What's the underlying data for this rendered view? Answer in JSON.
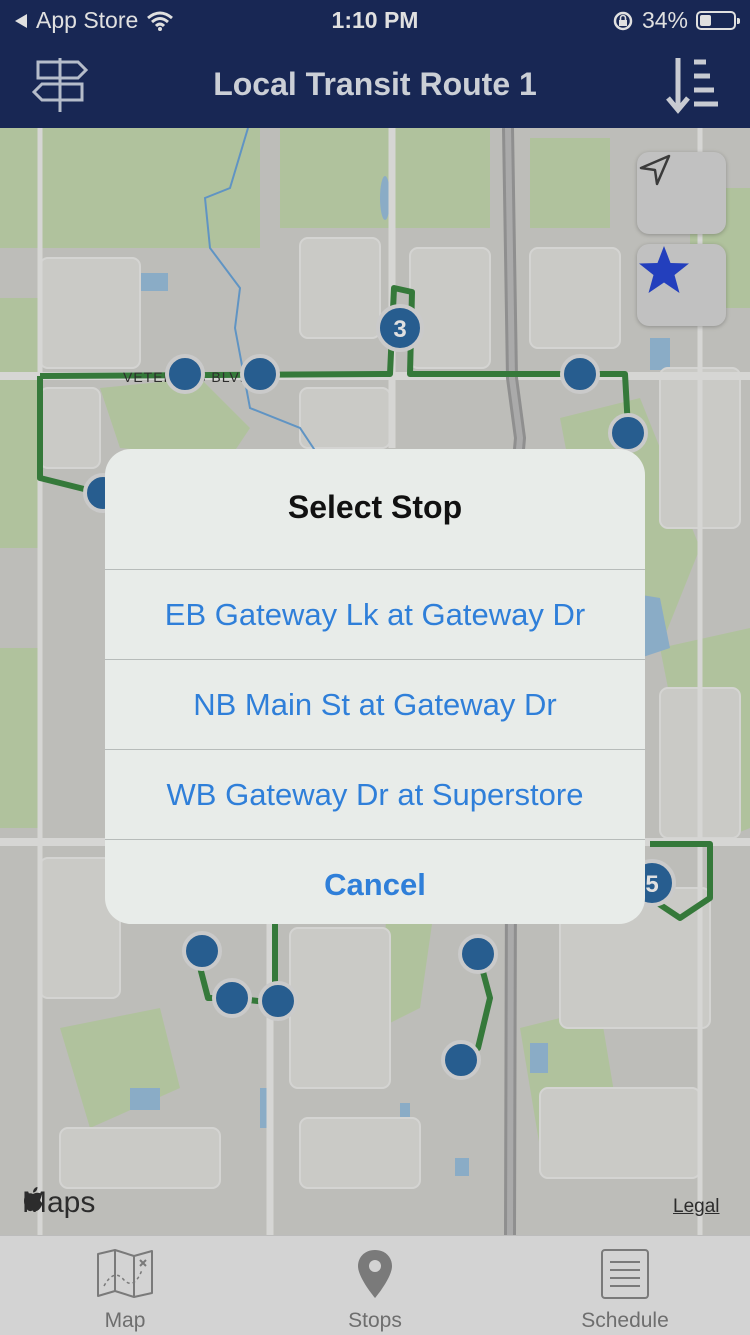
{
  "status_bar": {
    "back_label": "App Store",
    "time": "1:10 PM",
    "battery": "34%",
    "battery_level": 0.34
  },
  "header": {
    "title": "Local Transit Route 1",
    "left_icon": "signpost-icon",
    "right_icon": "sort-list-icon"
  },
  "map": {
    "street_label": "VETERANS BLVD NW",
    "cluster_labels": [
      "3",
      "5"
    ],
    "location_button_icon": "location-arrow-icon",
    "favorite_button_icon": "star-icon",
    "logo": "Maps",
    "legal_link": "Legal",
    "route_color": "#3d8a43",
    "stop_color": "#2d6aa3"
  },
  "action_sheet": {
    "title": "Select Stop",
    "options": [
      "EB Gateway Lk at Gateway Dr",
      "NB Main St at Gateway Dr",
      "WB Gateway Dr at Superstore"
    ],
    "cancel": "Cancel",
    "option_color": "#2f7fd9"
  },
  "tab_bar": {
    "tabs": [
      {
        "label": "Map",
        "icon": "map-icon"
      },
      {
        "label": "Stops",
        "icon": "map-pin-icon"
      },
      {
        "label": "Schedule",
        "icon": "schedule-icon"
      }
    ]
  },
  "colors": {
    "nav_background": "#1c2d60",
    "star": "#2848d8"
  }
}
